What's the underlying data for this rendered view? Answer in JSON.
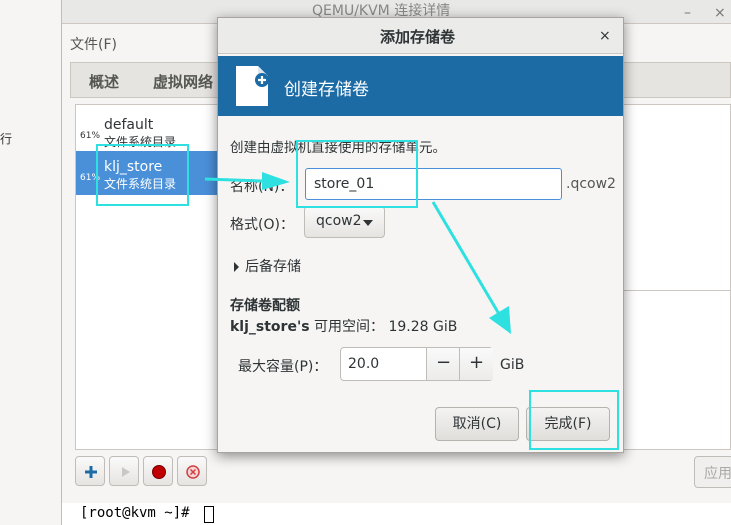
{
  "left_strip": {
    "fragment": "行"
  },
  "main_window": {
    "title": "QEMU/KVM 连接详情",
    "controls": {
      "minimize": "–",
      "close": "×"
    },
    "menu": "文件(F)",
    "tabs": [
      "概述",
      "虚拟网络"
    ],
    "pools": [
      {
        "percent": "61%",
        "name": "default",
        "type": "文件系统目录"
      },
      {
        "percent": "61%",
        "name": "klj_store",
        "type": "文件系统目录"
      }
    ],
    "apply_label": "应用"
  },
  "terminal": {
    "prompt": "[root@kvm ~]# "
  },
  "dialog": {
    "title": "添加存储卷",
    "close": "×",
    "banner_title": "创建存储卷",
    "description": "创建由虚拟机直接使用的存储单元。",
    "name_label": "名称(N)：",
    "name_value": "store_01",
    "name_suffix": ".qcow2",
    "format_label": "格式(O)：",
    "format_value": "qcow2",
    "backing_label": "后备存储",
    "quota_heading": "存储卷配额",
    "pool_name": "klj_store's",
    "available_label": " 可用空间：",
    "available_value": " 19.28 GiB",
    "max_label": "最大容量(P)：",
    "max_value": "20.0",
    "decrement": "−",
    "increment": "+",
    "unit": "GiB",
    "cancel_label": "取消(C)",
    "finish_label": "完成(F)"
  },
  "annotation_color": "#2fe0e0",
  "selection_color": "#4a90d9",
  "banner_color": "#1c6ba5"
}
